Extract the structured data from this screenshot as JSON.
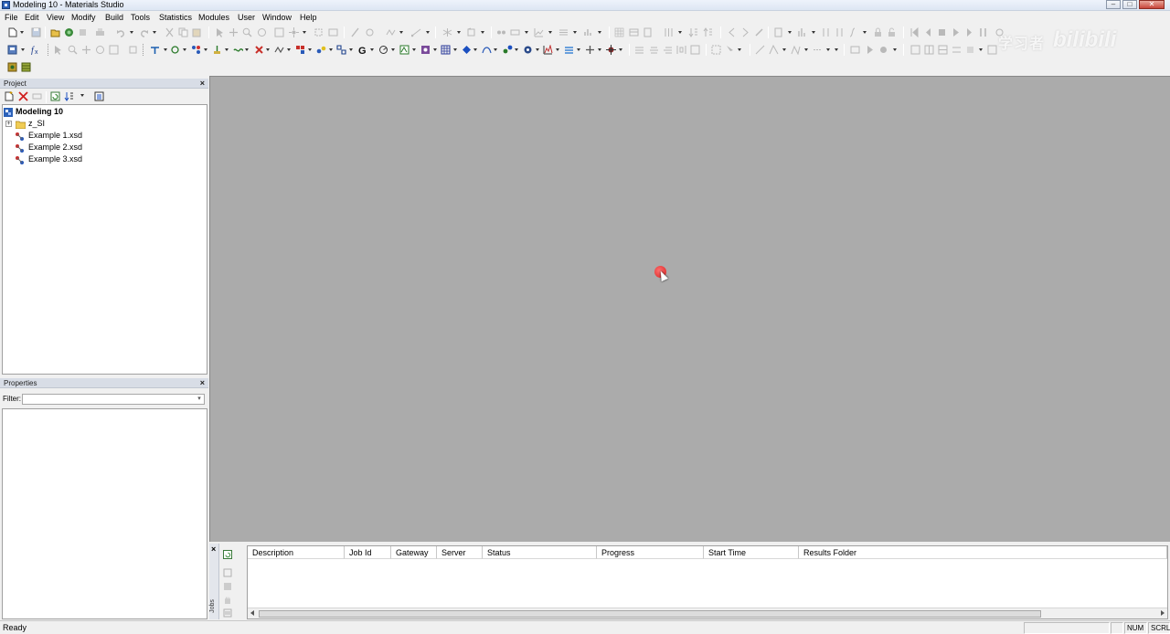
{
  "window": {
    "title": "Modeling 10 - Materials Studio",
    "minimize": "–",
    "maximize": "□",
    "close": "✕"
  },
  "menu": [
    "File",
    "Edit",
    "View",
    "Modify",
    "Build",
    "Tools",
    "Statistics",
    "Modules",
    "User",
    "Window",
    "Help"
  ],
  "watermark": {
    "brand": "学习者",
    "logo": "bilibili"
  },
  "project_panel": {
    "title": "Project",
    "close": "×",
    "root": "Modeling 10",
    "folder": "z_SI",
    "files": [
      "Example 1.xsd",
      "Example 2.xsd",
      "Example 3.xsd"
    ],
    "expander": "+"
  },
  "properties_panel": {
    "title": "Properties",
    "close": "×",
    "filter_label": "Filter:",
    "filter_value": "",
    "dropdown": "▾"
  },
  "jobs_panel": {
    "label": "Jobs",
    "close": "×",
    "columns": [
      "Description",
      "Job Id",
      "Gateway",
      "Server",
      "Status",
      "Progress",
      "Start Time",
      "Results Folder"
    ],
    "rows": []
  },
  "status": {
    "text": "Ready",
    "num": "NUM",
    "scrl": "SCRL"
  },
  "colors": {
    "workspace": "#ababab",
    "click_indicator": "#d8201e",
    "accent": "#2d62b8"
  }
}
